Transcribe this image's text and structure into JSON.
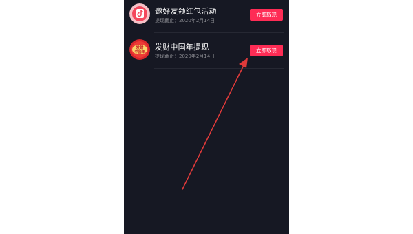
{
  "items": [
    {
      "title": "邀好友领红包活动",
      "subtitle": "提现截止：2020年2月14日",
      "button_label": "立即取现",
      "icon": "tiktok-red-envelope-icon"
    },
    {
      "title": "发财中国年提现",
      "subtitle": "提现截止：2020年2月14日",
      "button_label": "立即取现",
      "icon": "chinese-new-year-badge-icon",
      "icon_text": "发财中国年"
    }
  ],
  "colors": {
    "background": "#161823",
    "accent": "#fe2c55",
    "arrow": "#e03a3a"
  }
}
